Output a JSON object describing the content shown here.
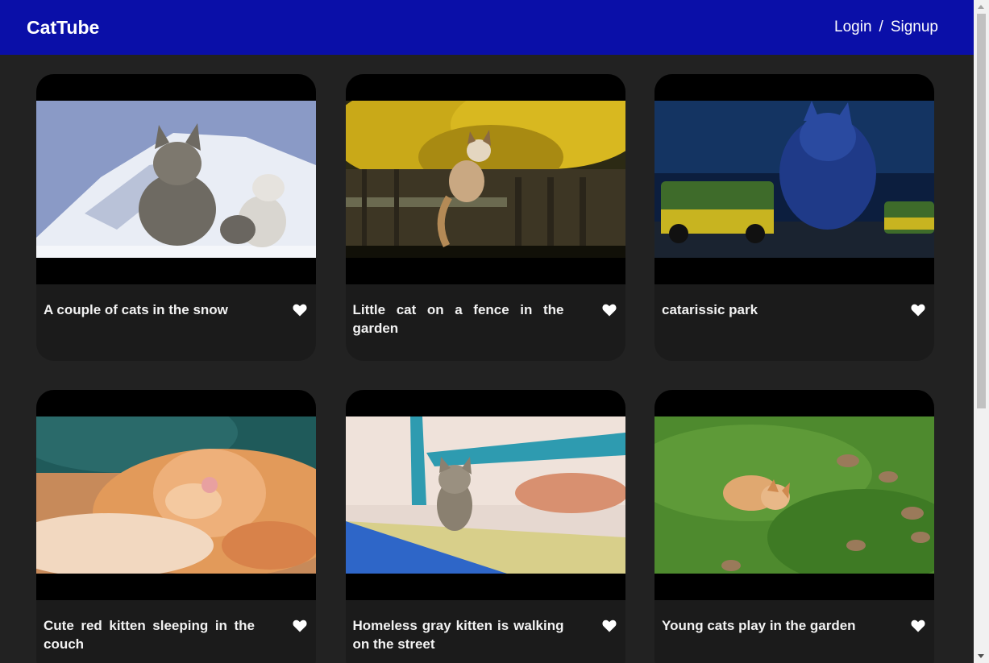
{
  "header": {
    "brand": "CatTube",
    "login": "Login",
    "separator": "/",
    "signup": "Signup"
  },
  "colors": {
    "header_bg": "#0a0fa8",
    "page_bg": "#222222",
    "card_bg": "#1b1b1b"
  },
  "videos": [
    {
      "title": "A couple of cats in the snow",
      "icon": "heart-icon"
    },
    {
      "title": "Little cat on a fence in the garden",
      "icon": "heart-icon"
    },
    {
      "title": "catarissic park",
      "icon": "heart-icon"
    },
    {
      "title": "Cute red kitten sleeping in the couch",
      "icon": "heart-icon"
    },
    {
      "title": "Homeless gray kitten is walking on the street",
      "icon": "heart-icon"
    },
    {
      "title": "Young cats play in the garden",
      "icon": "heart-icon"
    }
  ]
}
